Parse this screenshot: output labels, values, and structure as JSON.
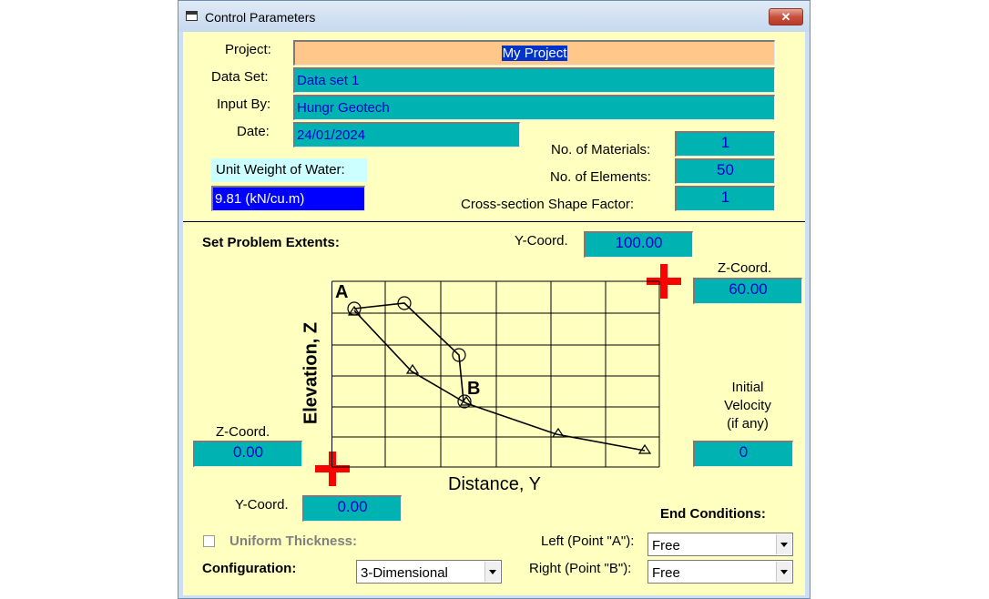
{
  "window": {
    "title": "Control Parameters",
    "close_glyph": "✕"
  },
  "header": {
    "project_label": "Project:",
    "project_value": "My Project",
    "dataset_label": "Data Set:",
    "dataset_value": "Data set 1",
    "inputby_label": "Input By:",
    "inputby_value": "Hungr Geotech",
    "date_label": "Date:",
    "date_value": "24/01/2024",
    "water_label": "Unit Weight of Water:",
    "water_value": "9.81  (kN/cu.m)",
    "materials_label": "No. of Materials:",
    "materials_value": "1",
    "elements_label": "No. of Elements:",
    "elements_value": "50",
    "shape_label": "Cross-section Shape Factor:",
    "shape_value": "1"
  },
  "extents": {
    "section_title": "Set Problem Extents:",
    "max_y_label": "Y-Coord.",
    "max_y_value": "100.00",
    "max_z_label": "Z-Coord.",
    "max_z_value": "60.00",
    "min_z_label": "Z-Coord.",
    "min_z_value": "0.00",
    "min_y_label": "Y-Coord.",
    "min_y_value": "0.00",
    "velocity_label_1": "Initial",
    "velocity_label_2": "Velocity",
    "velocity_label_3": "(if any)",
    "velocity_value": "0"
  },
  "diagram": {
    "y_axis_label": "Elevation, Z",
    "x_axis_label": "Distance, Y",
    "point_a_label": "A",
    "point_b_label": "B"
  },
  "options": {
    "uniform_label": "Uniform Thickness:",
    "uniform_checked": false,
    "configuration_label": "Configuration:",
    "configuration_value": "3-Dimensional",
    "end_conditions_title": "End Conditions:",
    "left_label": "Left (Point \"A\"):",
    "left_value": "Free",
    "right_label": "Right (Point \"B\"):",
    "right_value": "Free"
  },
  "colors": {
    "field": "#00b3b3",
    "project_field": "#ffc78a",
    "water_field": "#0000ff",
    "panel": "#ffffc0",
    "marker": "#ff0000"
  }
}
